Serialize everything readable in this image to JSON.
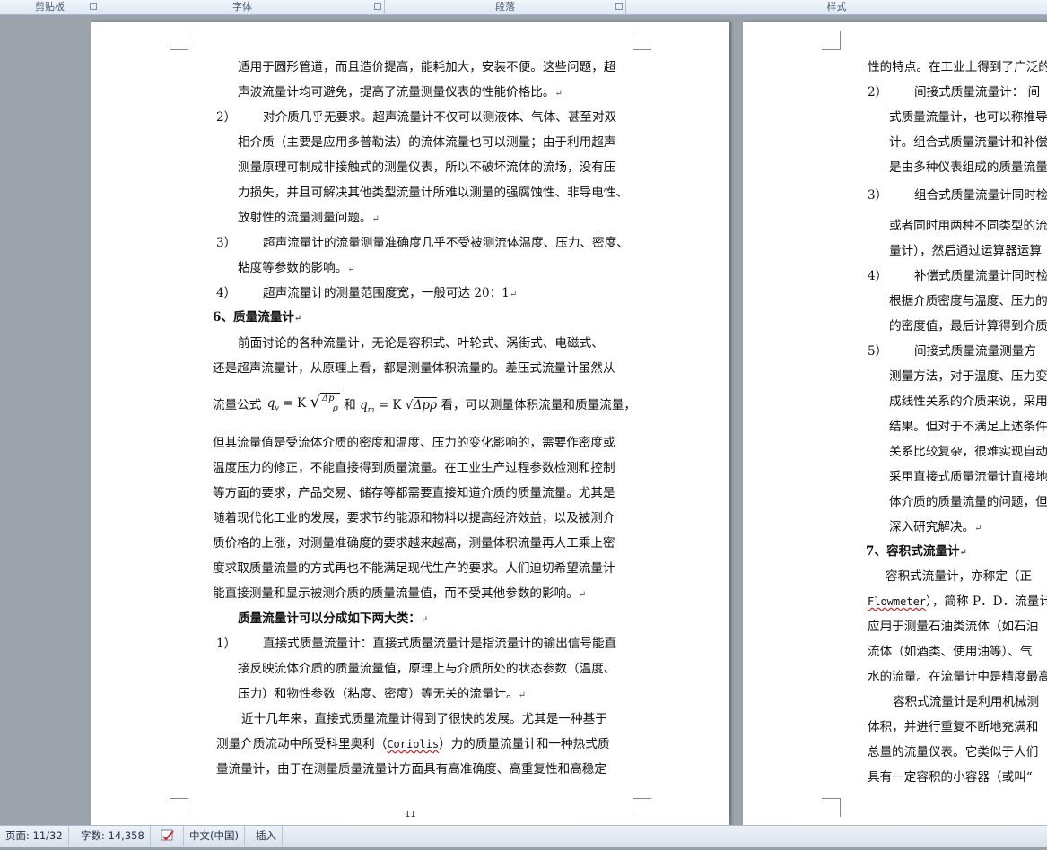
{
  "ribbon": {
    "groups": [
      "剪贴板",
      "字体",
      "段落",
      "样式"
    ]
  },
  "page1": {
    "lines": [
      "适用于圆形管道，而且造价提高，能耗加大，安装不便。这些问题，超",
      "声波流量计均可避免，提高了流量测量仪表的性能价格比。",
      "对介质几乎无要求。超声流量计不仅可以测液体、气体、甚至对双",
      "相介质（主要是应用多普勒法）的流体流量也可以测量；由于利用超声",
      "测量原理可制成非接触式的测量仪表，所以不破坏流体的流场，没有压",
      "力损失，并且可解决其他类型流量计所难以测量的强腐蚀性、非导电性、",
      "放射性的流量测量问题。",
      "超声流量计的流量测量准确度几乎不受被测流体温度、压力、密度、",
      "粘度等参数的影响。",
      "超声流量计的测量范围度宽，一般可达 20：1",
      "6、质量流量计",
      "前面讨论的各种流量计，无论是容积式、叶轮式、涡街式、电磁式、",
      "还是超声流量计，从原理上看，都是测量体积流量的。差压式流量计虽然从",
      "流量公式",
      "和",
      "看，可以测量体积流量和质量流量，",
      "但其流量值是受流体介质的密度和温度、压力的变化影响的，需要作密度或",
      "温度压力的修正，不能直接得到质量流量。在工业生产过程参数检测和控制",
      "等方面的要求，产品交易、储存等都需要直接知道介质的质量流量。尤其是",
      "随着现代化工业的发展，要求节约能源和物料以提高经济效益，以及被测介",
      "质价格的上涨，对测量准确度的要求越来越高，测量体积流量再人工乘上密",
      "度求取质量流量的方式再也不能满足现代生产的要求。人们迫切希望流量计",
      "能直接测量和显示被测介质的质量流量值，而不受其他参数的影响。",
      "质量流量计可以分成如下两大类：",
      "直接式质量流量计：直接式质量流量计是指流量计的输出信号能直",
      "接反映流体介质的质量流量值，原理上与介质所处的状态参数（温度、",
      "压力）和物性参数（粘度、密度）等无关的流量计。",
      "近十几年来，直接式质量流量计得到了很快的发展。尤其是一种基于",
      "测量介质流动中所受科里奥利（",
      "Coriolis",
      "）力的质量流量计和一种热式质",
      "量流量计，由于在测量质量流量计方面具有高准确度、高重复性和高稳定"
    ],
    "nums": [
      "2）",
      "3）",
      "4）",
      "1）"
    ],
    "formula1": {
      "lhs": "q",
      "sub": "v",
      "eq": "= K",
      "num": "Δp",
      "den": "ρ"
    },
    "formula2": {
      "lhs": "q",
      "sub": "m",
      "eq": "= K",
      "rad": "Δpρ"
    },
    "page_number": "11",
    "mark": "↵"
  },
  "page2": {
    "lines": [
      "性的特点。在工业上得到了广泛的",
      "间接式质量流量计：  间",
      "式质量流量计，也可以称推导",
      "计。组合式质量流量计和补偿",
      "是由多种仪表组成的质量流量",
      "组合式质量流量计同时检",
      "或者同时用两种不同类型的流",
      "量计），然后通过运算器运算",
      "补偿式质量流量计同时检",
      "根据介质密度与温度、压力的",
      "的密度值，最后计算得到介质",
      "间接式质量流量测量方",
      "测量方法，对于温度、压力变",
      "成线性关系的介质来说，采用",
      "结果。但对于不满足上述条件",
      "关系比较复杂，很难实现自动",
      "采用直接式质量流量计直接地",
      "体介质的质量流量的问题，但",
      "深入研究解决。",
      "7、容积式流量计",
      "容积式流量计，亦称定（正",
      "Flowmeter",
      "），简称 P．D．流量计",
      "应用于测量石油类流体（如石油",
      "流体（如酒类、使用油等）、气",
      "水的流量。在流量计中是精度最高",
      "容积式流量计是利用机械测",
      "体积，并进行重复不断地充满和",
      "总量的流量仪表。它类似于人们",
      "具有一定容积的小容器（或叫“"
    ],
    "nums": [
      "2）",
      "3）",
      "4）",
      "5）"
    ]
  },
  "status": {
    "page": "页面: 11/32",
    "words": "字数: 14,358",
    "lang": "中文(中国)",
    "mode": "插入"
  }
}
